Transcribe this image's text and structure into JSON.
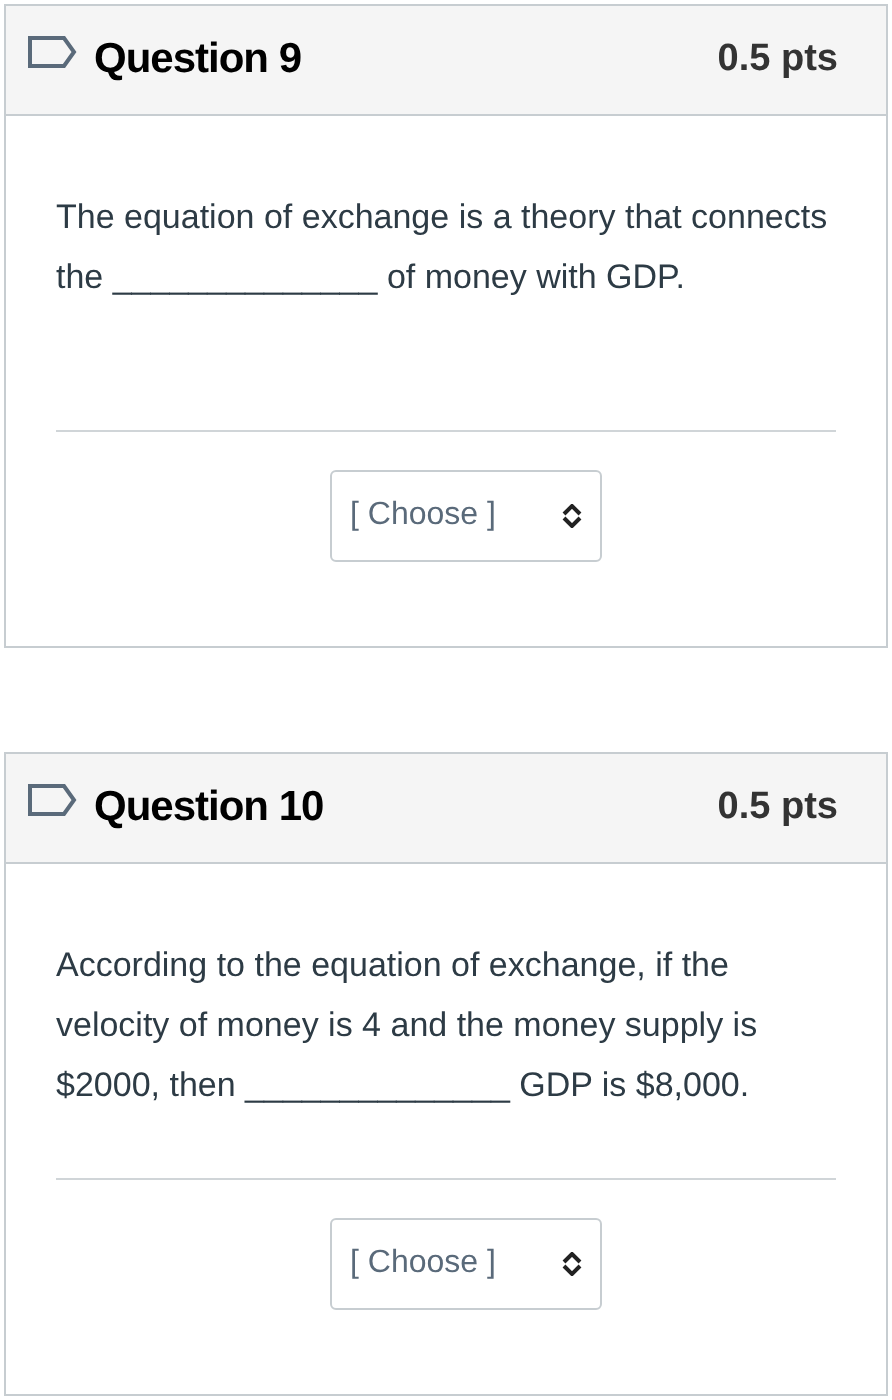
{
  "questions": [
    {
      "title": "Question 9",
      "points": "0.5 pts",
      "text": "The equation of exchange is a theory that connects the ______________ of money with GDP.",
      "select": {
        "value": "[ Choose ]"
      }
    },
    {
      "title": "Question 10",
      "points": "0.5 pts",
      "text": "According to the equation of exchange, if the velocity of money is 4 and the money supply is $2000, then ______________ GDP is $8,000.",
      "select": {
        "value": "[ Choose ]"
      }
    }
  ]
}
